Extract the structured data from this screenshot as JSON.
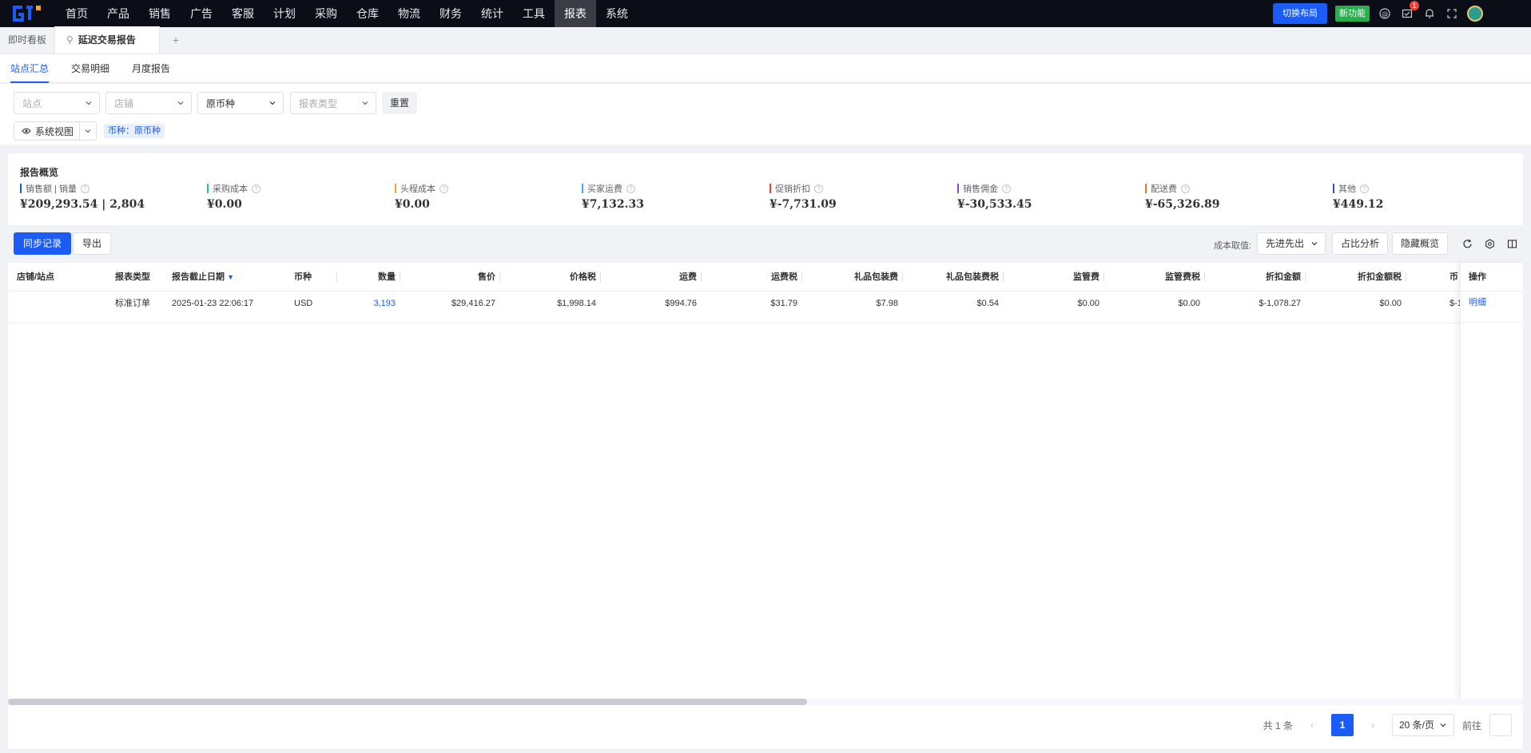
{
  "nav": {
    "items": [
      "首页",
      "产品",
      "销售",
      "广告",
      "客服",
      "计划",
      "采购",
      "仓库",
      "物流",
      "财务",
      "统计",
      "工具",
      "报表",
      "系统"
    ],
    "active_index": 12,
    "switch_layout_label": "切换布局",
    "new_feature_label": "新功能",
    "notification_count": "1"
  },
  "page_tabs": {
    "dashboard_label": "即时看板",
    "active_label": "延迟交易报告",
    "add_label": "+"
  },
  "sub_tabs": [
    "站点汇总",
    "交易明细",
    "月度报告"
  ],
  "filters": {
    "site_placeholder": "站点",
    "store_placeholder": "店铺",
    "currency_value": "原币种",
    "report_type_placeholder": "报表类型",
    "reset_label": "重置",
    "view_label": "系统视图",
    "currency_tag": "币种：原币种"
  },
  "summary": {
    "title": "报告概览",
    "metrics": [
      {
        "label": "销售额 | 销量",
        "value": "¥209,293.54 | 2,804",
        "color": "#1a5cf5"
      },
      {
        "label": "采购成本",
        "value": "¥0.00",
        "color": "#20c0a0"
      },
      {
        "label": "头程成本",
        "value": "¥0.00",
        "color": "#f5a623"
      },
      {
        "label": "买家运费",
        "value": "¥7,132.33",
        "color": "#40a9ff"
      },
      {
        "label": "促销折扣",
        "value": "¥-7,731.09",
        "color": "#f04134"
      },
      {
        "label": "销售佣金",
        "value": "¥-30,533.45",
        "color": "#7b4ae2"
      },
      {
        "label": "配送费",
        "value": "¥-65,326.89",
        "color": "#fa6e1e"
      },
      {
        "label": "其他",
        "value": "¥449.12",
        "color": "#2f54a8"
      }
    ]
  },
  "toolbar": {
    "sync_label": "同步记录",
    "export_label": "导出",
    "cost_label": "成本取值:",
    "cost_value": "先进先出",
    "ratio_label": "占比分析",
    "hide_overview_label": "隐藏概览"
  },
  "table": {
    "columns": [
      "店铺/站点",
      "报表类型",
      "报告截止日期",
      "币种",
      "数量",
      "售价",
      "价格税",
      "运费",
      "运费税",
      "礼品包装费",
      "礼品包装费税",
      "监管费",
      "监管费税",
      "折扣金额",
      "折扣金额税",
      "币"
    ],
    "rows": [
      [
        "",
        "标准订单",
        "2025-01-23 22:06:17",
        "USD",
        "3,193",
        "$29,416.27",
        "$1,998.14",
        "$994.76",
        "$31.79",
        "$7.98",
        "$0.54",
        "$0.00",
        "$0.00",
        "$-1,078.27",
        "$0.00",
        "$-1"
      ]
    ],
    "action_header": "操作",
    "action_label": "明细"
  },
  "pagination": {
    "total_text": "共 1 条",
    "current_page": "1",
    "page_size": "20 条/页",
    "goto_label": "前往"
  }
}
